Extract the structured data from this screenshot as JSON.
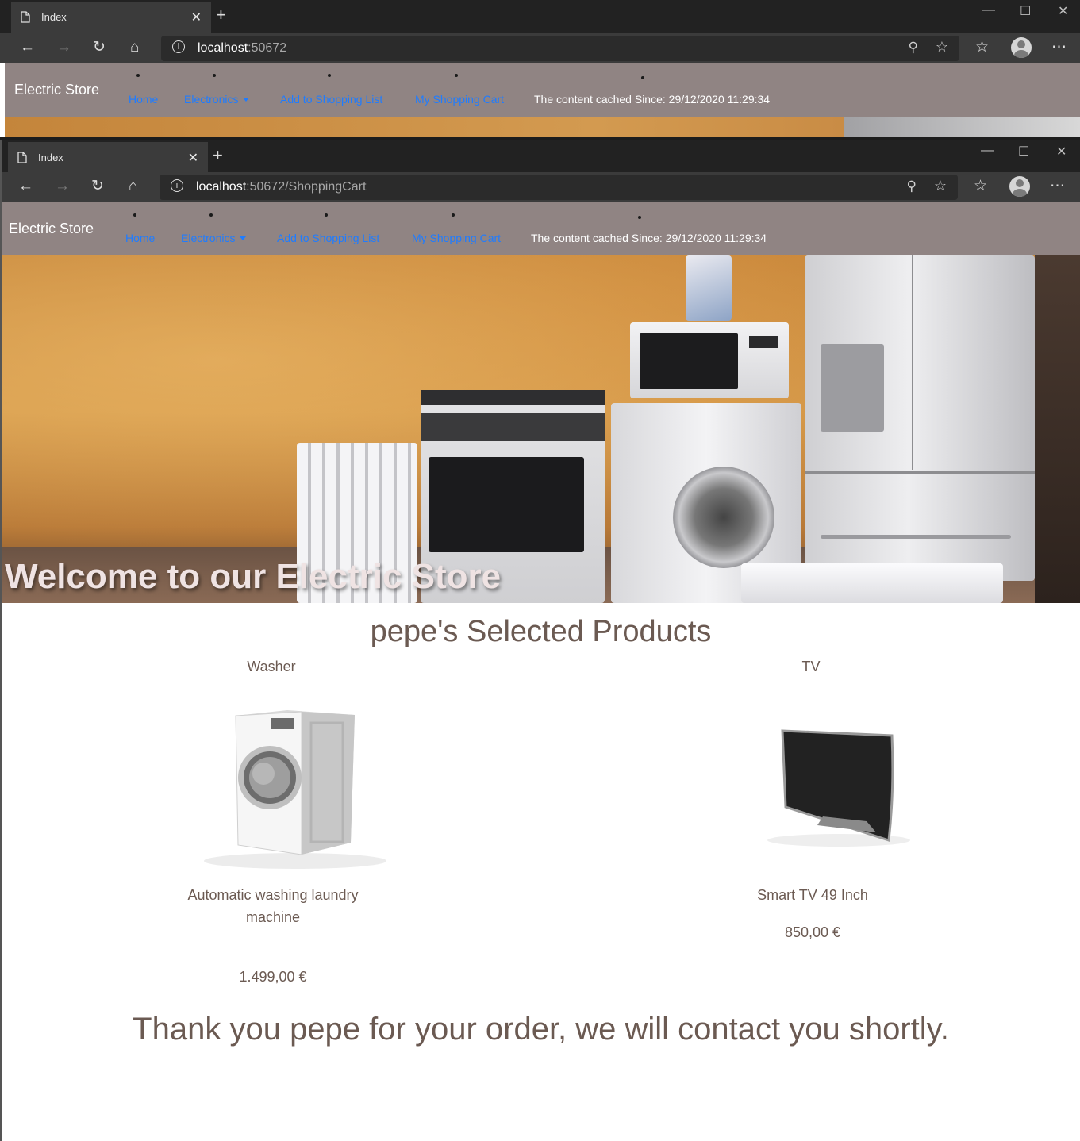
{
  "back_window": {
    "tab_title": "Index",
    "url_host": "localhost",
    "url_rest": ":50672",
    "navbar": {
      "brand": "Electric Store",
      "links": [
        "Home",
        "Electronics",
        "Add to Shopping List",
        "My Shopping Cart"
      ],
      "cache_text": "The content cached Since: 29/12/2020 11:29:34"
    }
  },
  "front_window": {
    "tab_title": "Index",
    "url_host": "localhost",
    "url_rest": ":50672/ShoppingCart",
    "navbar": {
      "brand": "Electric Store",
      "links": [
        "Home",
        "Electronics",
        "Add to Shopping List",
        "My Shopping Cart"
      ],
      "cache_text": "The content cached Since: 29/12/2020 11:29:34"
    },
    "hero_title": "Welcome to our Electric Store",
    "section_title": "pepe's Selected Products",
    "products": [
      {
        "name": "Washer",
        "description": "Automatic washing laundry machine",
        "price": "1.499,00 €",
        "image": "washing-machine"
      },
      {
        "name": "TV",
        "description": "Smart TV 49 Inch",
        "price": "850,00 €",
        "image": "curved-tv"
      }
    ],
    "thank_you": "Thank you pepe for your order, we will contact you shortly."
  },
  "icons": {
    "tab": "document-icon",
    "back": "back-arrow-icon",
    "forward": "forward-arrow-icon",
    "refresh": "refresh-icon",
    "home": "home-icon",
    "info": "info-icon",
    "zoom": "zoom-out-icon",
    "favorite": "star-icon",
    "favorites": "favorites-list-icon",
    "profile": "profile-avatar-icon",
    "more": "more-icon"
  },
  "colors": {
    "navbar_bg": "#908483",
    "link": "#1f7cff",
    "text": "#6b5a52",
    "browser_chrome": "#3b3b3b"
  }
}
